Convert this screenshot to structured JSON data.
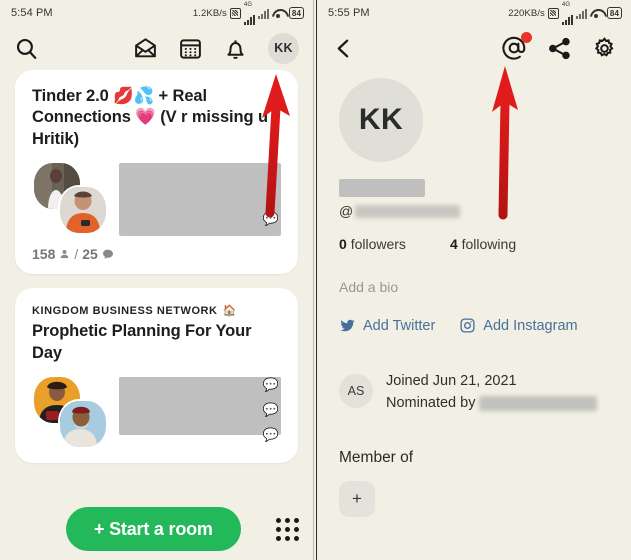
{
  "left_screen": {
    "status_bar": {
      "time": "5:54 PM",
      "network_speed": "1.2KB/s",
      "signal_sup": "4G",
      "battery": "84"
    },
    "header": {
      "search_icon": "search-icon",
      "invite_icon": "envelope-icon",
      "calendar_icon": "calendar-icon",
      "notifications_icon": "bell-icon",
      "avatar_initials": "KK"
    },
    "feed": [
      {
        "club": "",
        "title": "Tinder 2.0 💋💦 + Real Connections 💗 (V r missing u Hritik)",
        "speakers_count": "158",
        "people_icon": "person-icon",
        "separator": "/",
        "messages_count": "25",
        "chat_icon": "speech-bubble-icon"
      },
      {
        "club": "KINGDOM BUSINESS NETWORK",
        "house_icon": "house-icon",
        "title": "Prophetic Planning For Your Day"
      }
    ],
    "bottom_bar": {
      "start_room_label": "+ Start a room",
      "grid_icon": "grid-apps-icon"
    }
  },
  "right_screen": {
    "status_bar": {
      "time": "5:55 PM",
      "network_speed": "220KB/s",
      "signal_sup": "4G",
      "battery": "84"
    },
    "header": {
      "back_icon": "chevron-left-icon",
      "mentions_icon": "at-sign-icon",
      "mentions_badge": true,
      "share_icon": "share-icon",
      "settings_icon": "gear-icon"
    },
    "profile": {
      "avatar_initials": "KK",
      "handle_prefix": "@",
      "followers_count": "0",
      "followers_label": "followers",
      "following_count": "4",
      "following_label": "following",
      "add_bio_label": "Add a bio",
      "add_twitter_label": "Add Twitter",
      "add_instagram_label": "Add Instagram",
      "twitter_icon": "twitter-bird-icon",
      "instagram_icon": "instagram-icon",
      "nominator_initials": "AS",
      "joined_text": "Joined Jun 21, 2021",
      "nominated_prefix": "Nominated by",
      "member_of_label": "Member of",
      "add_club_label": "+"
    }
  },
  "annotations": {
    "arrow_color": "#e01b1b",
    "left_arrow_target": "avatar-hdr",
    "right_arrow_target": "mentions-icon"
  }
}
